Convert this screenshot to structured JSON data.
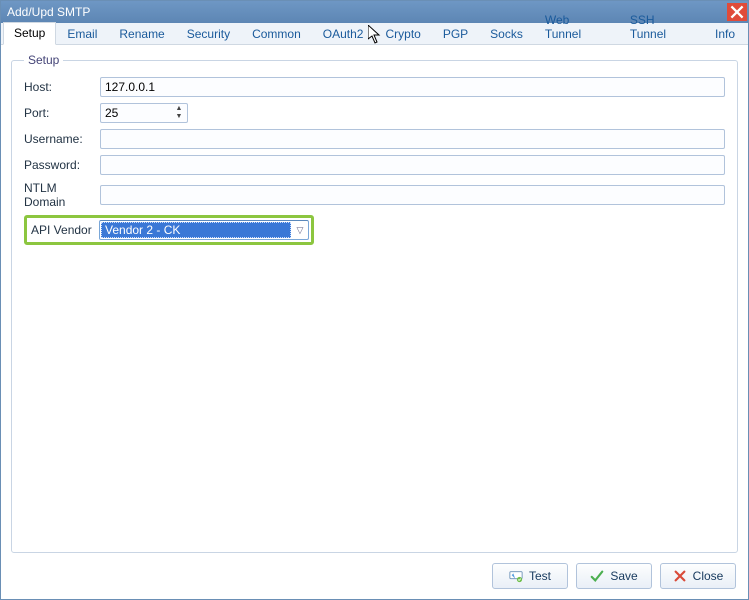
{
  "window": {
    "title": "Add/Upd SMTP"
  },
  "tabs": [
    "Setup",
    "Email",
    "Rename",
    "Security",
    "Common",
    "OAuth2",
    "Crypto",
    "PGP",
    "Socks",
    "Web Tunnel",
    "SSH Tunnel",
    "Info"
  ],
  "active_tab": 0,
  "groupbox": {
    "legend": "Setup"
  },
  "fields": {
    "host_label": "Host:",
    "host_value": "127.0.0.1",
    "port_label": "Port:",
    "port_value": "25",
    "username_label": "Username:",
    "username_value": "",
    "password_label": "Password:",
    "password_value": "",
    "ntlm_label": "NTLM Domain",
    "ntlm_value": "",
    "apivendor_label": "API Vendor",
    "apivendor_value": "Vendor 2 - CK"
  },
  "buttons": {
    "test": "Test",
    "save": "Save",
    "close": "Close"
  }
}
